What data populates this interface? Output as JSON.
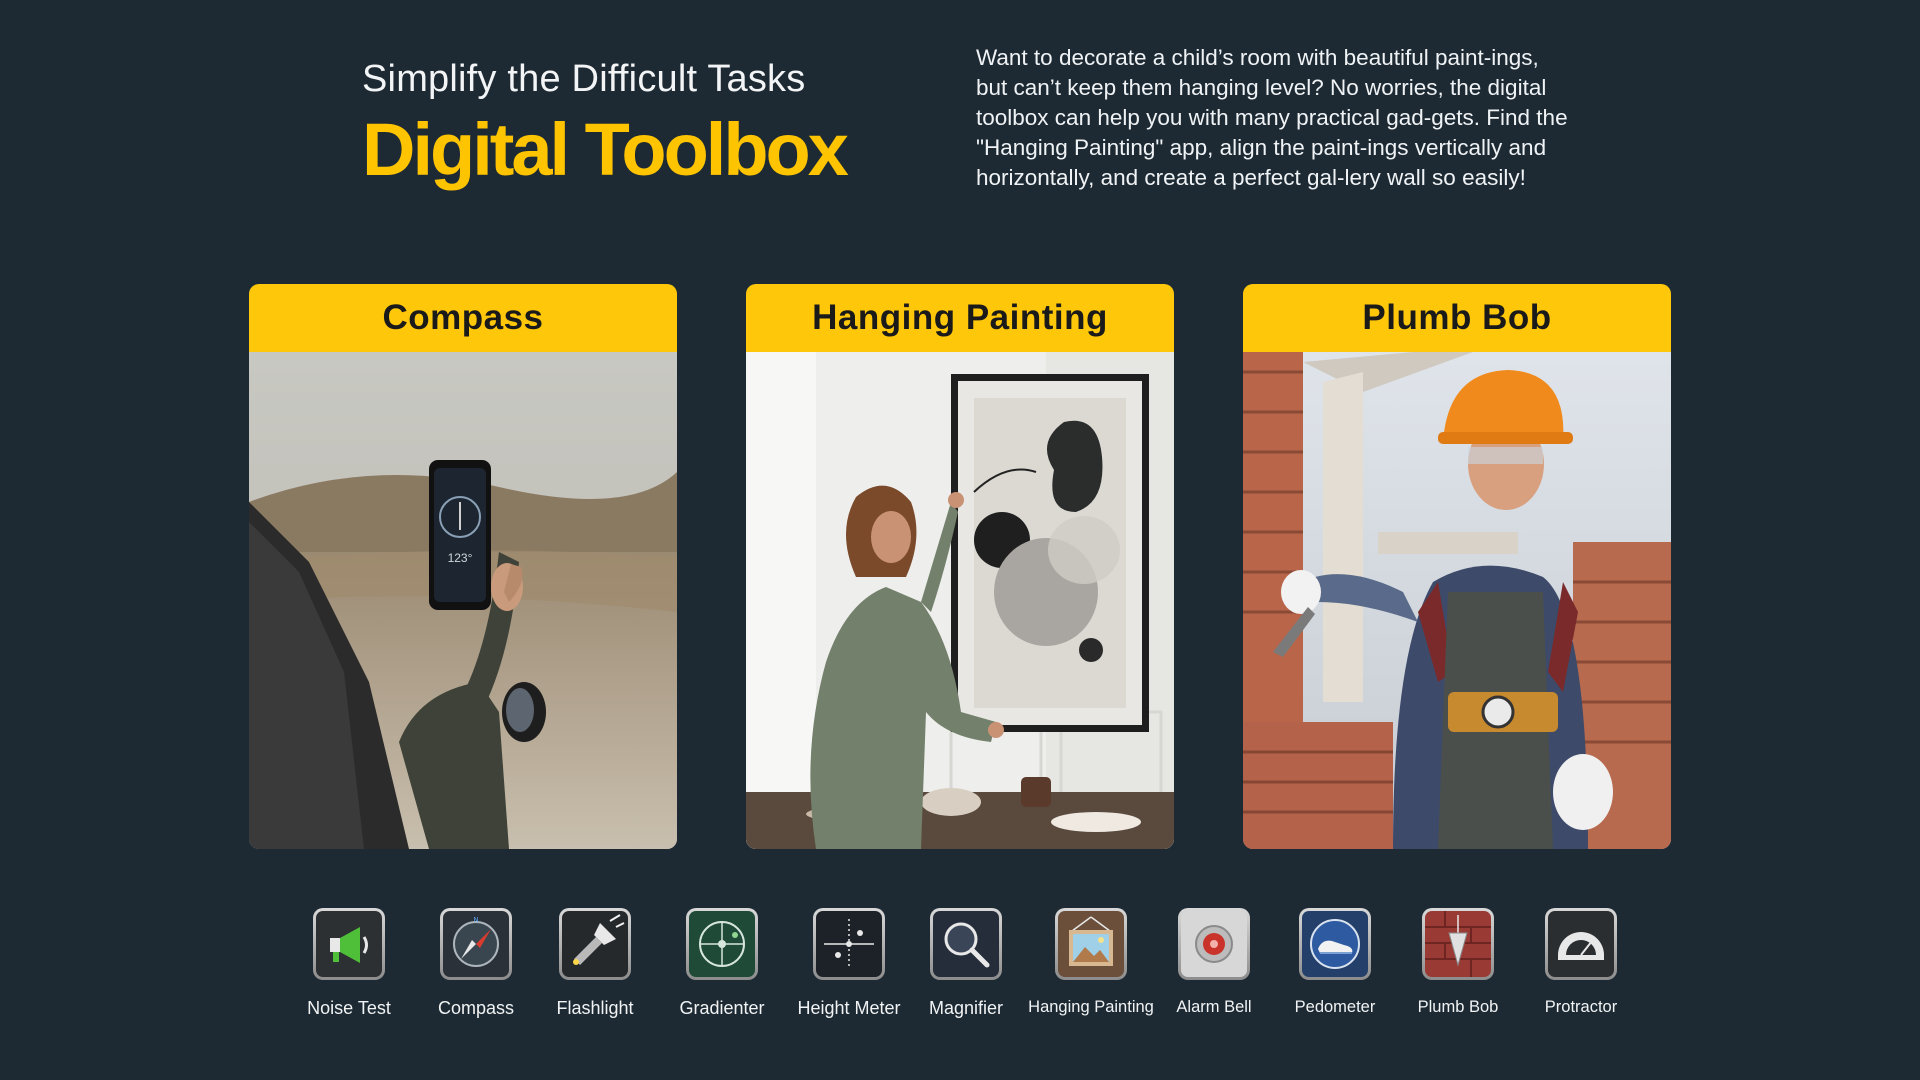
{
  "header": {
    "subtitle": "Simplify the Difficult Tasks",
    "title": "Digital Toolbox",
    "description": "Want to decorate a child’s room with beautiful paint-ings, but can’t keep them hanging level? No worries, the digital toolbox can help you with many practical gad-gets. Find the \"Hanging Painting\" app, align the paint-ings vertically and horizontally, and create a perfect gal-lery wall so easily!"
  },
  "cards": [
    {
      "title": "Compass",
      "phone_readout": "123°"
    },
    {
      "title": "Hanging Painting"
    },
    {
      "title": "Plumb Bob"
    }
  ],
  "tools": [
    {
      "label": "Noise Test",
      "icon": "megaphone-icon"
    },
    {
      "label": "Compass",
      "icon": "compass-icon"
    },
    {
      "label": "Flashlight",
      "icon": "flashlight-icon"
    },
    {
      "label": "Gradienter",
      "icon": "level-icon"
    },
    {
      "label": "Height Meter",
      "icon": "height-meter-icon"
    },
    {
      "label": "Magnifier",
      "icon": "magnifier-icon"
    },
    {
      "label": "Hanging Painting",
      "icon": "hanging-painting-icon"
    },
    {
      "label": "Alarm Bell",
      "icon": "alarm-bell-icon"
    },
    {
      "label": "Pedometer",
      "icon": "pedometer-icon"
    },
    {
      "label": "Plumb Bob",
      "icon": "plumb-bob-icon"
    },
    {
      "label": "Protractor",
      "icon": "protractor-icon"
    }
  ],
  "colors": {
    "background": "#1d2a33",
    "accent": "#ffc709",
    "title_yellow": "#ffc400"
  }
}
